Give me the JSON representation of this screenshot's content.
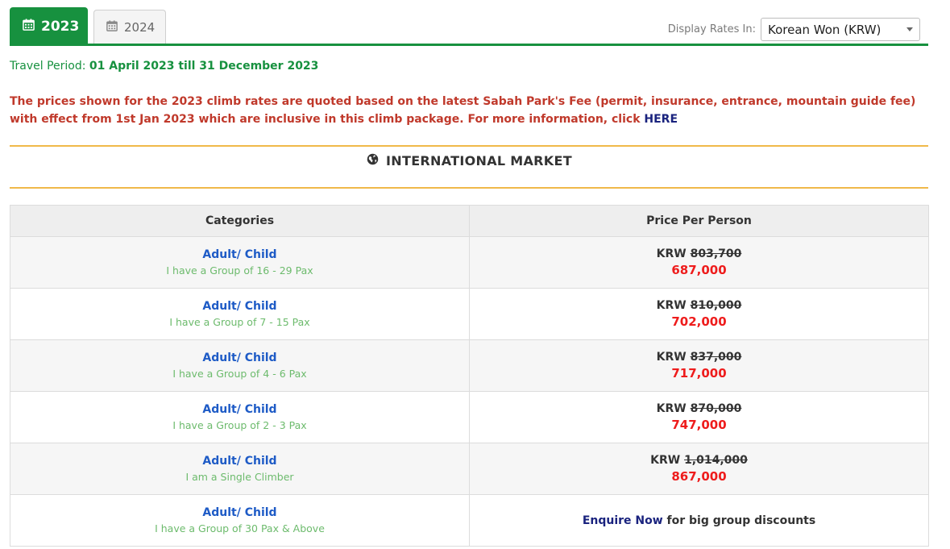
{
  "tabs": [
    {
      "label": "2023",
      "active": true,
      "icon": "calendar-icon"
    },
    {
      "label": "2024",
      "active": false,
      "icon": "calendar-icon"
    }
  ],
  "rates": {
    "label": "Display Rates In:",
    "selected": "Korean Won (KRW)"
  },
  "travel_period": {
    "label": "Travel Period:",
    "value": "01 April 2023 till 31 December 2023"
  },
  "notice": {
    "text": "The prices shown for the 2023 climb rates are quoted based on the latest Sabah Park's Fee (permit, insurance, entrance, mountain guide fee) with effect from 1st Jan 2023 which are inclusive in this climb package. For more information, click",
    "link": "HERE"
  },
  "market": {
    "title": "INTERNATIONAL MARKET",
    "icon": "globe-icon"
  },
  "table": {
    "headers": [
      "Categories",
      "Price Per Person"
    ],
    "rows": [
      {
        "category": "Adult/ Child",
        "group": "I have a Group of 16 - 29 Pax",
        "currency": "KRW",
        "old_price": "803,700",
        "new_price": "687,000"
      },
      {
        "category": "Adult/ Child",
        "group": "I have a Group of 7 - 15 Pax",
        "currency": "KRW",
        "old_price": "810,000",
        "new_price": "702,000"
      },
      {
        "category": "Adult/ Child",
        "group": "I have a Group of 4 - 6 Pax",
        "currency": "KRW",
        "old_price": "837,000",
        "new_price": "717,000"
      },
      {
        "category": "Adult/ Child",
        "group": "I have a Group of 2 - 3 Pax",
        "currency": "KRW",
        "old_price": "870,000",
        "new_price": "747,000"
      },
      {
        "category": "Adult/ Child",
        "group": "I am a Single Climber",
        "currency": "KRW",
        "old_price": "1,014,000",
        "new_price": "867,000"
      },
      {
        "category": "Adult/ Child",
        "group": "I have a Group of 30 Pax & Above",
        "enquire_link": "Enquire Now",
        "enquire_text": "for big group discounts"
      }
    ]
  },
  "colors": {
    "green": "#17913f",
    "red": "#ee1c1c",
    "notice_red": "#c0392b",
    "blue": "#1e5bc6",
    "orange_rule": "#f0b94a"
  }
}
